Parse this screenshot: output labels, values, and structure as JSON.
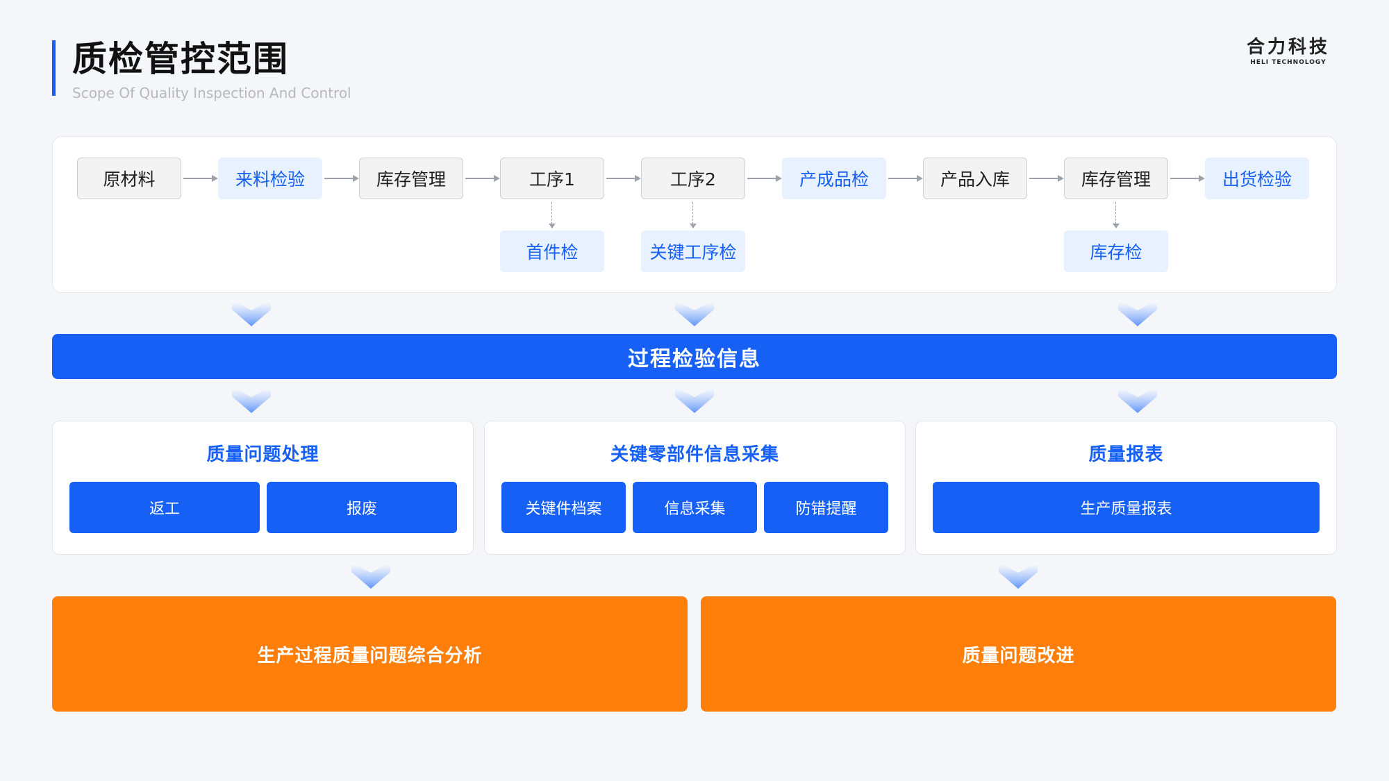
{
  "header": {
    "title": "质检管控范围",
    "subtitle": "Scope Of Quality Inspection And Control",
    "brand_cn": "合力科技",
    "brand_en": "HELI TECHNOLOGY"
  },
  "flow": {
    "steps": [
      "原材料",
      "来料检验",
      "库存管理",
      "工序1",
      "工序2",
      "产成品检",
      "产品入库",
      "库存管理",
      "出货检验"
    ],
    "sub_checks": [
      "首件检",
      "关键工序检",
      "库存检"
    ]
  },
  "info_bar": {
    "label": "过程检验信息"
  },
  "cards": [
    {
      "title": "质量问题处理",
      "buttons": [
        "返工",
        "报废"
      ]
    },
    {
      "title": "关键零部件信息采集",
      "buttons": [
        "关键件档案",
        "信息采集",
        "防错提醒"
      ]
    },
    {
      "title": "质量报表",
      "buttons": [
        "生产质量报表"
      ]
    }
  ],
  "results": [
    "生产过程质量问题综合分析",
    "质量问题改进"
  ],
  "colors": {
    "primary": "#1660f5",
    "light_check_bg": "#e7f1ff",
    "orange": "#ff7f0a",
    "chevron": "#6b9bf7"
  }
}
